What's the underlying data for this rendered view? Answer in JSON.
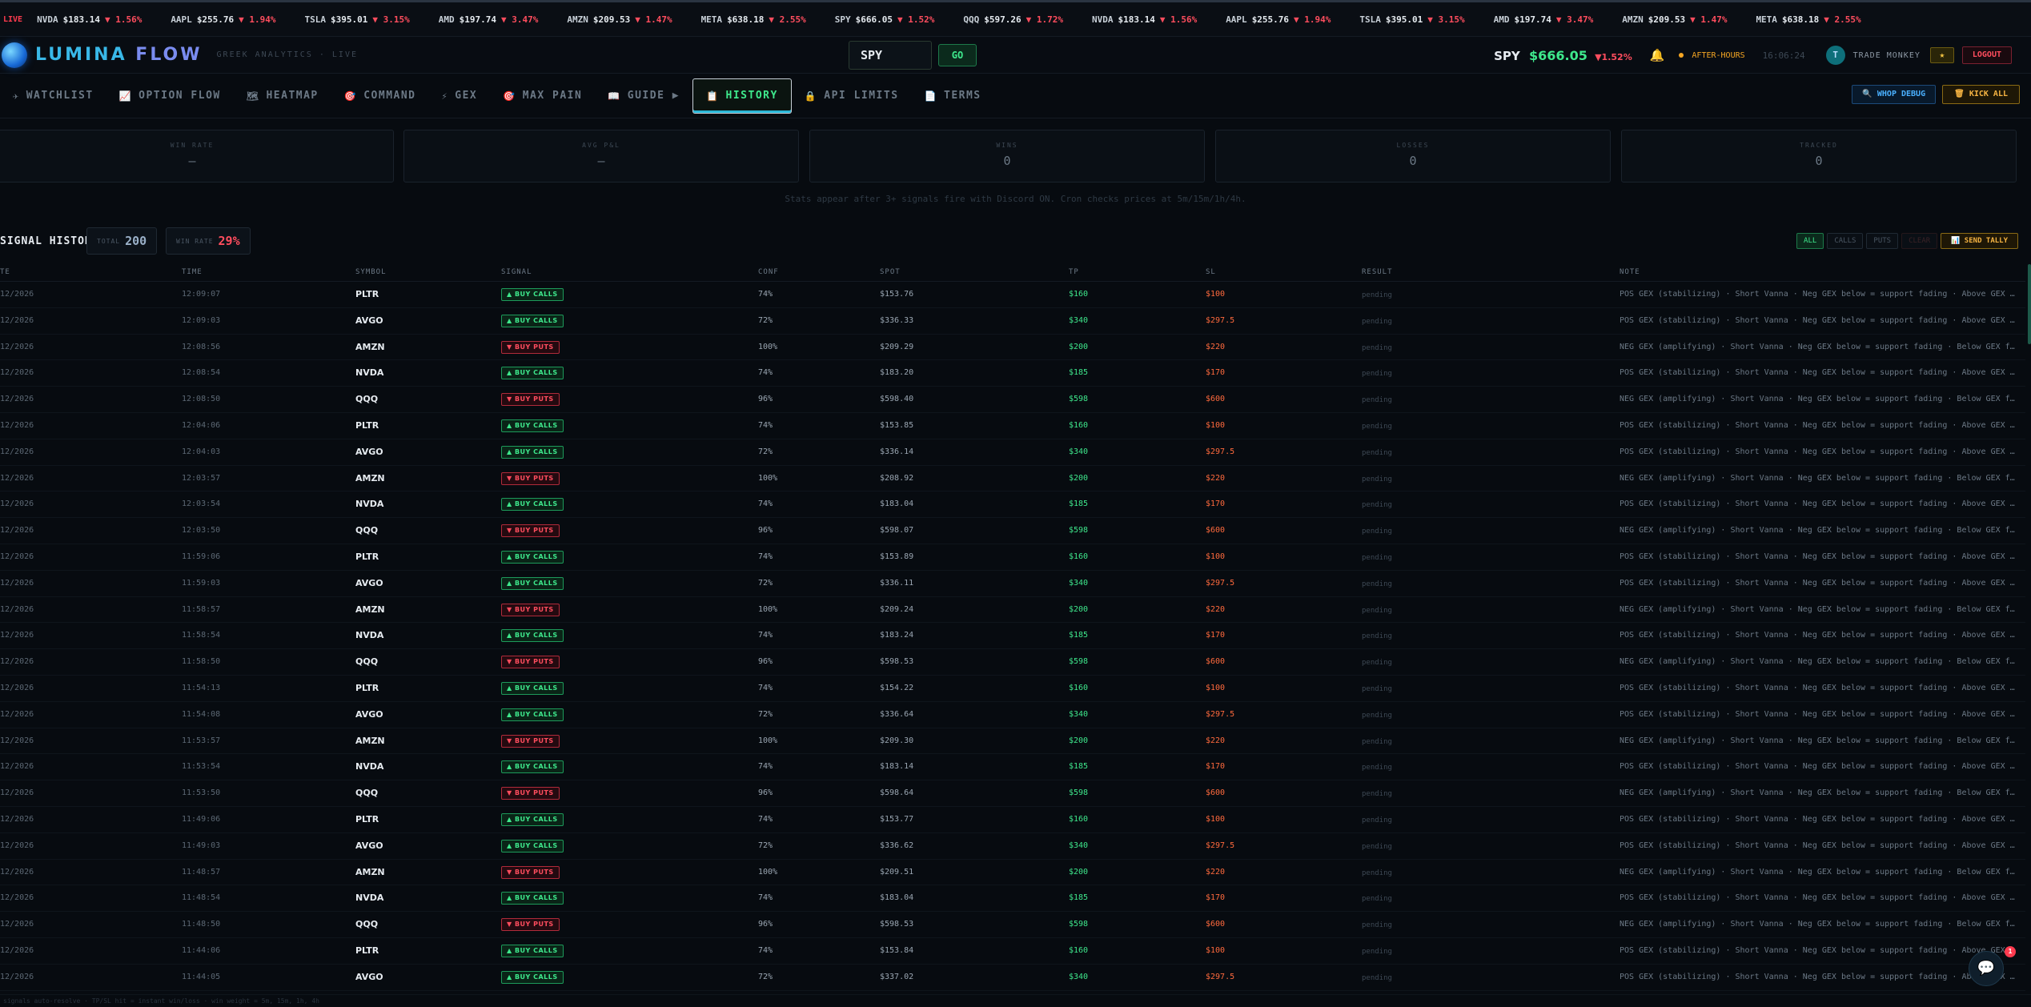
{
  "ticker": {
    "live": "LIVE",
    "items": [
      {
        "sym": "NVDA",
        "px": "$183.14",
        "chg": "▼ 1.56%"
      },
      {
        "sym": "AAPL",
        "px": "$255.76",
        "chg": "▼ 1.94%"
      },
      {
        "sym": "TSLA",
        "px": "$395.01",
        "chg": "▼ 3.15%"
      },
      {
        "sym": "AMD",
        "px": "$197.74",
        "chg": "▼ 3.47%"
      },
      {
        "sym": "AMZN",
        "px": "$209.53",
        "chg": "▼ 1.47%"
      },
      {
        "sym": "META",
        "px": "$638.18",
        "chg": "▼ 2.55%"
      },
      {
        "sym": "SPY",
        "px": "$666.05",
        "chg": "▼ 1.52%"
      },
      {
        "sym": "QQQ",
        "px": "$597.26",
        "chg": "▼ 1.72%"
      },
      {
        "sym": "NVDA",
        "px": "$183.14",
        "chg": "▼ 1.56%"
      },
      {
        "sym": "AAPL",
        "px": "$255.76",
        "chg": "▼ 1.94%"
      },
      {
        "sym": "TSLA",
        "px": "$395.01",
        "chg": "▼ 3.15%"
      },
      {
        "sym": "AMD",
        "px": "$197.74",
        "chg": "▼ 3.47%"
      },
      {
        "sym": "AMZN",
        "px": "$209.53",
        "chg": "▼ 1.47%"
      },
      {
        "sym": "META",
        "px": "$638.18",
        "chg": "▼ 2.55%"
      }
    ]
  },
  "header": {
    "logo_a": "LUMINA",
    "logo_b": "FLOW",
    "subtitle": "GREEK ANALYTICS · LIVE",
    "search_value": "SPY",
    "go_label": "GO",
    "quote_sym": "SPY",
    "quote_px": "$666.05",
    "quote_chg": "▼1.52%",
    "session": "AFTER-HOURS",
    "clock": "16:06:24",
    "avatar_initial": "T",
    "username": "TRADE MONKEY",
    "star_label": "★",
    "logout_label": "LOGOUT"
  },
  "nav": {
    "items": [
      {
        "icon": "✈",
        "label": "WATCHLIST"
      },
      {
        "icon": "📈",
        "label": "OPTION FLOW"
      },
      {
        "icon": "🗺",
        "label": "HEATMAP"
      },
      {
        "icon": "🎯",
        "label": "COMMAND"
      },
      {
        "icon": "⚡",
        "label": "GEX"
      },
      {
        "icon": "🎯",
        "label": "MAX PAIN"
      },
      {
        "icon": "📖",
        "label": "GUIDE ▶"
      },
      {
        "icon": "📋",
        "label": "HISTORY"
      },
      {
        "icon": "🔒",
        "label": "API LIMITS"
      },
      {
        "icon": "📄",
        "label": "TERMS"
      }
    ],
    "whop_label": "🔍 WHOP DEBUG",
    "kick_label": "🗑 KICK ALL"
  },
  "stats": {
    "cards": [
      {
        "label": "WIN RATE",
        "value": "—"
      },
      {
        "label": "AVG P&L",
        "value": "—"
      },
      {
        "label": "WINS",
        "value": "0"
      },
      {
        "label": "LOSSES",
        "value": "0"
      },
      {
        "label": "TRACKED",
        "value": "0"
      }
    ],
    "note": "Stats appear after 3+ signals fire with Discord ON. Cron checks prices at 5m/15m/1h/4h."
  },
  "history": {
    "title": "SIGNAL HISTORY",
    "total_label": "TOTAL",
    "total_value": "200",
    "winrate_label": "WIN RATE",
    "winrate_value": "29%",
    "filters": [
      "ALL",
      "CALLS",
      "PUTS",
      "CLEAR"
    ],
    "tally_label": "📊 SEND TALLY",
    "columns": [
      "TE",
      "TIME",
      "SYMBOL",
      "SIGNAL",
      "CONF",
      "SPOT",
      "TP",
      "SL",
      "RESULT",
      "NOTE"
    ],
    "rows": [
      {
        "date": "12/2026",
        "time": "12:09:07",
        "sym": "PLTR",
        "sig": "▲ BUY CALLS",
        "type": "calls",
        "conf": "74%",
        "spot": "$153.76",
        "tp": "$160",
        "sl": "$100",
        "res": "pending",
        "note": "POS GEX (stabilizing) · Short Vanna · Neg GEX below = support fading · Above GEX flip"
      },
      {
        "date": "12/2026",
        "time": "12:09:03",
        "sym": "AVGO",
        "sig": "▲ BUY CALLS",
        "type": "calls",
        "conf": "72%",
        "spot": "$336.33",
        "tp": "$340",
        "sl": "$297.5",
        "res": "pending",
        "note": "POS GEX (stabilizing) · Short Vanna · Neg GEX below = support fading · Above GEX flip"
      },
      {
        "date": "12/2026",
        "time": "12:08:56",
        "sym": "AMZN",
        "sig": "▼ BUY PUTS",
        "type": "puts",
        "conf": "100%",
        "spot": "$209.29",
        "tp": "$200",
        "sl": "$220",
        "res": "pending",
        "note": "NEG GEX (amplifying) · Short Vanna · Neg GEX below = support fading · Below GEX flip"
      },
      {
        "date": "12/2026",
        "time": "12:08:54",
        "sym": "NVDA",
        "sig": "▲ BUY CALLS",
        "type": "calls",
        "conf": "74%",
        "spot": "$183.20",
        "tp": "$185",
        "sl": "$170",
        "res": "pending",
        "note": "POS GEX (stabilizing) · Short Vanna · Neg GEX below = support fading · Above GEX flip"
      },
      {
        "date": "12/2026",
        "time": "12:08:50",
        "sym": "QQQ",
        "sig": "▼ BUY PUTS",
        "type": "puts",
        "conf": "96%",
        "spot": "$598.40",
        "tp": "$598",
        "sl": "$600",
        "res": "pending",
        "note": "NEG GEX (amplifying) · Short Vanna · Neg GEX below = support fading · Below GEX flip"
      },
      {
        "date": "12/2026",
        "time": "12:04:06",
        "sym": "PLTR",
        "sig": "▲ BUY CALLS",
        "type": "calls",
        "conf": "74%",
        "spot": "$153.85",
        "tp": "$160",
        "sl": "$100",
        "res": "pending",
        "note": "POS GEX (stabilizing) · Short Vanna · Neg GEX below = support fading · Above GEX flip"
      },
      {
        "date": "12/2026",
        "time": "12:04:03",
        "sym": "AVGO",
        "sig": "▲ BUY CALLS",
        "type": "calls",
        "conf": "72%",
        "spot": "$336.14",
        "tp": "$340",
        "sl": "$297.5",
        "res": "pending",
        "note": "POS GEX (stabilizing) · Short Vanna · Neg GEX below = support fading · Above GEX flip"
      },
      {
        "date": "12/2026",
        "time": "12:03:57",
        "sym": "AMZN",
        "sig": "▼ BUY PUTS",
        "type": "puts",
        "conf": "100%",
        "spot": "$208.92",
        "tp": "$200",
        "sl": "$220",
        "res": "pending",
        "note": "NEG GEX (amplifying) · Short Vanna · Neg GEX below = support fading · Below GEX flip"
      },
      {
        "date": "12/2026",
        "time": "12:03:54",
        "sym": "NVDA",
        "sig": "▲ BUY CALLS",
        "type": "calls",
        "conf": "74%",
        "spot": "$183.04",
        "tp": "$185",
        "sl": "$170",
        "res": "pending",
        "note": "POS GEX (stabilizing) · Short Vanna · Neg GEX below = support fading · Above GEX flip"
      },
      {
        "date": "12/2026",
        "time": "12:03:50",
        "sym": "QQQ",
        "sig": "▼ BUY PUTS",
        "type": "puts",
        "conf": "96%",
        "spot": "$598.07",
        "tp": "$598",
        "sl": "$600",
        "res": "pending",
        "note": "NEG GEX (amplifying) · Short Vanna · Neg GEX below = support fading · Below GEX flip"
      },
      {
        "date": "12/2026",
        "time": "11:59:06",
        "sym": "PLTR",
        "sig": "▲ BUY CALLS",
        "type": "calls",
        "conf": "74%",
        "spot": "$153.89",
        "tp": "$160",
        "sl": "$100",
        "res": "pending",
        "note": "POS GEX (stabilizing) · Short Vanna · Neg GEX below = support fading · Above GEX flip"
      },
      {
        "date": "12/2026",
        "time": "11:59:03",
        "sym": "AVGO",
        "sig": "▲ BUY CALLS",
        "type": "calls",
        "conf": "72%",
        "spot": "$336.11",
        "tp": "$340",
        "sl": "$297.5",
        "res": "pending",
        "note": "POS GEX (stabilizing) · Short Vanna · Neg GEX below = support fading · Above GEX flip"
      },
      {
        "date": "12/2026",
        "time": "11:58:57",
        "sym": "AMZN",
        "sig": "▼ BUY PUTS",
        "type": "puts",
        "conf": "100%",
        "spot": "$209.24",
        "tp": "$200",
        "sl": "$220",
        "res": "pending",
        "note": "NEG GEX (amplifying) · Short Vanna · Neg GEX below = support fading · Below GEX flip"
      },
      {
        "date": "12/2026",
        "time": "11:58:54",
        "sym": "NVDA",
        "sig": "▲ BUY CALLS",
        "type": "calls",
        "conf": "74%",
        "spot": "$183.24",
        "tp": "$185",
        "sl": "$170",
        "res": "pending",
        "note": "POS GEX (stabilizing) · Short Vanna · Neg GEX below = support fading · Above GEX flip"
      },
      {
        "date": "12/2026",
        "time": "11:58:50",
        "sym": "QQQ",
        "sig": "▼ BUY PUTS",
        "type": "puts",
        "conf": "96%",
        "spot": "$598.53",
        "tp": "$598",
        "sl": "$600",
        "res": "pending",
        "note": "NEG GEX (amplifying) · Short Vanna · Neg GEX below = support fading · Below GEX flip"
      },
      {
        "date": "12/2026",
        "time": "11:54:13",
        "sym": "PLTR",
        "sig": "▲ BUY CALLS",
        "type": "calls",
        "conf": "74%",
        "spot": "$154.22",
        "tp": "$160",
        "sl": "$100",
        "res": "pending",
        "note": "POS GEX (stabilizing) · Short Vanna · Neg GEX below = support fading · Above GEX flip"
      },
      {
        "date": "12/2026",
        "time": "11:54:08",
        "sym": "AVGO",
        "sig": "▲ BUY CALLS",
        "type": "calls",
        "conf": "72%",
        "spot": "$336.64",
        "tp": "$340",
        "sl": "$297.5",
        "res": "pending",
        "note": "POS GEX (stabilizing) · Short Vanna · Neg GEX below = support fading · Above GEX flip"
      },
      {
        "date": "12/2026",
        "time": "11:53:57",
        "sym": "AMZN",
        "sig": "▼ BUY PUTS",
        "type": "puts",
        "conf": "100%",
        "spot": "$209.30",
        "tp": "$200",
        "sl": "$220",
        "res": "pending",
        "note": "NEG GEX (amplifying) · Short Vanna · Neg GEX below = support fading · Below GEX flip"
      },
      {
        "date": "12/2026",
        "time": "11:53:54",
        "sym": "NVDA",
        "sig": "▲ BUY CALLS",
        "type": "calls",
        "conf": "74%",
        "spot": "$183.14",
        "tp": "$185",
        "sl": "$170",
        "res": "pending",
        "note": "POS GEX (stabilizing) · Short Vanna · Neg GEX below = support fading · Above GEX flip"
      },
      {
        "date": "12/2026",
        "time": "11:53:50",
        "sym": "QQQ",
        "sig": "▼ BUY PUTS",
        "type": "puts",
        "conf": "96%",
        "spot": "$598.64",
        "tp": "$598",
        "sl": "$600",
        "res": "pending",
        "note": "NEG GEX (amplifying) · Short Vanna · Neg GEX below = support fading · Below GEX flip"
      },
      {
        "date": "12/2026",
        "time": "11:49:06",
        "sym": "PLTR",
        "sig": "▲ BUY CALLS",
        "type": "calls",
        "conf": "74%",
        "spot": "$153.77",
        "tp": "$160",
        "sl": "$100",
        "res": "pending",
        "note": "POS GEX (stabilizing) · Short Vanna · Neg GEX below = support fading · Above GEX flip"
      },
      {
        "date": "12/2026",
        "time": "11:49:03",
        "sym": "AVGO",
        "sig": "▲ BUY CALLS",
        "type": "calls",
        "conf": "72%",
        "spot": "$336.62",
        "tp": "$340",
        "sl": "$297.5",
        "res": "pending",
        "note": "POS GEX (stabilizing) · Short Vanna · Neg GEX below = support fading · Above GEX flip"
      },
      {
        "date": "12/2026",
        "time": "11:48:57",
        "sym": "AMZN",
        "sig": "▼ BUY PUTS",
        "type": "puts",
        "conf": "100%",
        "spot": "$209.51",
        "tp": "$200",
        "sl": "$220",
        "res": "pending",
        "note": "NEG GEX (amplifying) · Short Vanna · Neg GEX below = support fading · Below GEX flip"
      },
      {
        "date": "12/2026",
        "time": "11:48:54",
        "sym": "NVDA",
        "sig": "▲ BUY CALLS",
        "type": "calls",
        "conf": "74%",
        "spot": "$183.04",
        "tp": "$185",
        "sl": "$170",
        "res": "pending",
        "note": "POS GEX (stabilizing) · Short Vanna · Neg GEX below = support fading · Above GEX flip"
      },
      {
        "date": "12/2026",
        "time": "11:48:50",
        "sym": "QQQ",
        "sig": "▼ BUY PUTS",
        "type": "puts",
        "conf": "96%",
        "spot": "$598.53",
        "tp": "$598",
        "sl": "$600",
        "res": "pending",
        "note": "NEG GEX (amplifying) · Short Vanna · Neg GEX below = support fading · Below GEX flip"
      },
      {
        "date": "12/2026",
        "time": "11:44:06",
        "sym": "PLTR",
        "sig": "▲ BUY CALLS",
        "type": "calls",
        "conf": "74%",
        "spot": "$153.84",
        "tp": "$160",
        "sl": "$100",
        "res": "pending",
        "note": "POS GEX (stabilizing) · Short Vanna · Neg GEX below = support fading · Above GEX flip"
      },
      {
        "date": "12/2026",
        "time": "11:44:05",
        "sym": "AVGO",
        "sig": "▲ BUY CALLS",
        "type": "calls",
        "conf": "72%",
        "spot": "$337.02",
        "tp": "$340",
        "sl": "$297.5",
        "res": "pending",
        "note": "POS GEX (stabilizing) · Short Vanna · Neg GEX below = support fading · Above GEX flip"
      }
    ]
  },
  "footer": "signals auto-resolve · TP/SL hit = instant win/loss · win weight = 5m, 15m, 1h, 4h",
  "chat": {
    "icon": "💬",
    "badge": "1"
  },
  "colors": {
    "accent_green": "#3ee88c",
    "accent_red": "#ff4d5e",
    "accent_cyan": "#2ab7d8",
    "background": "#070b10"
  }
}
